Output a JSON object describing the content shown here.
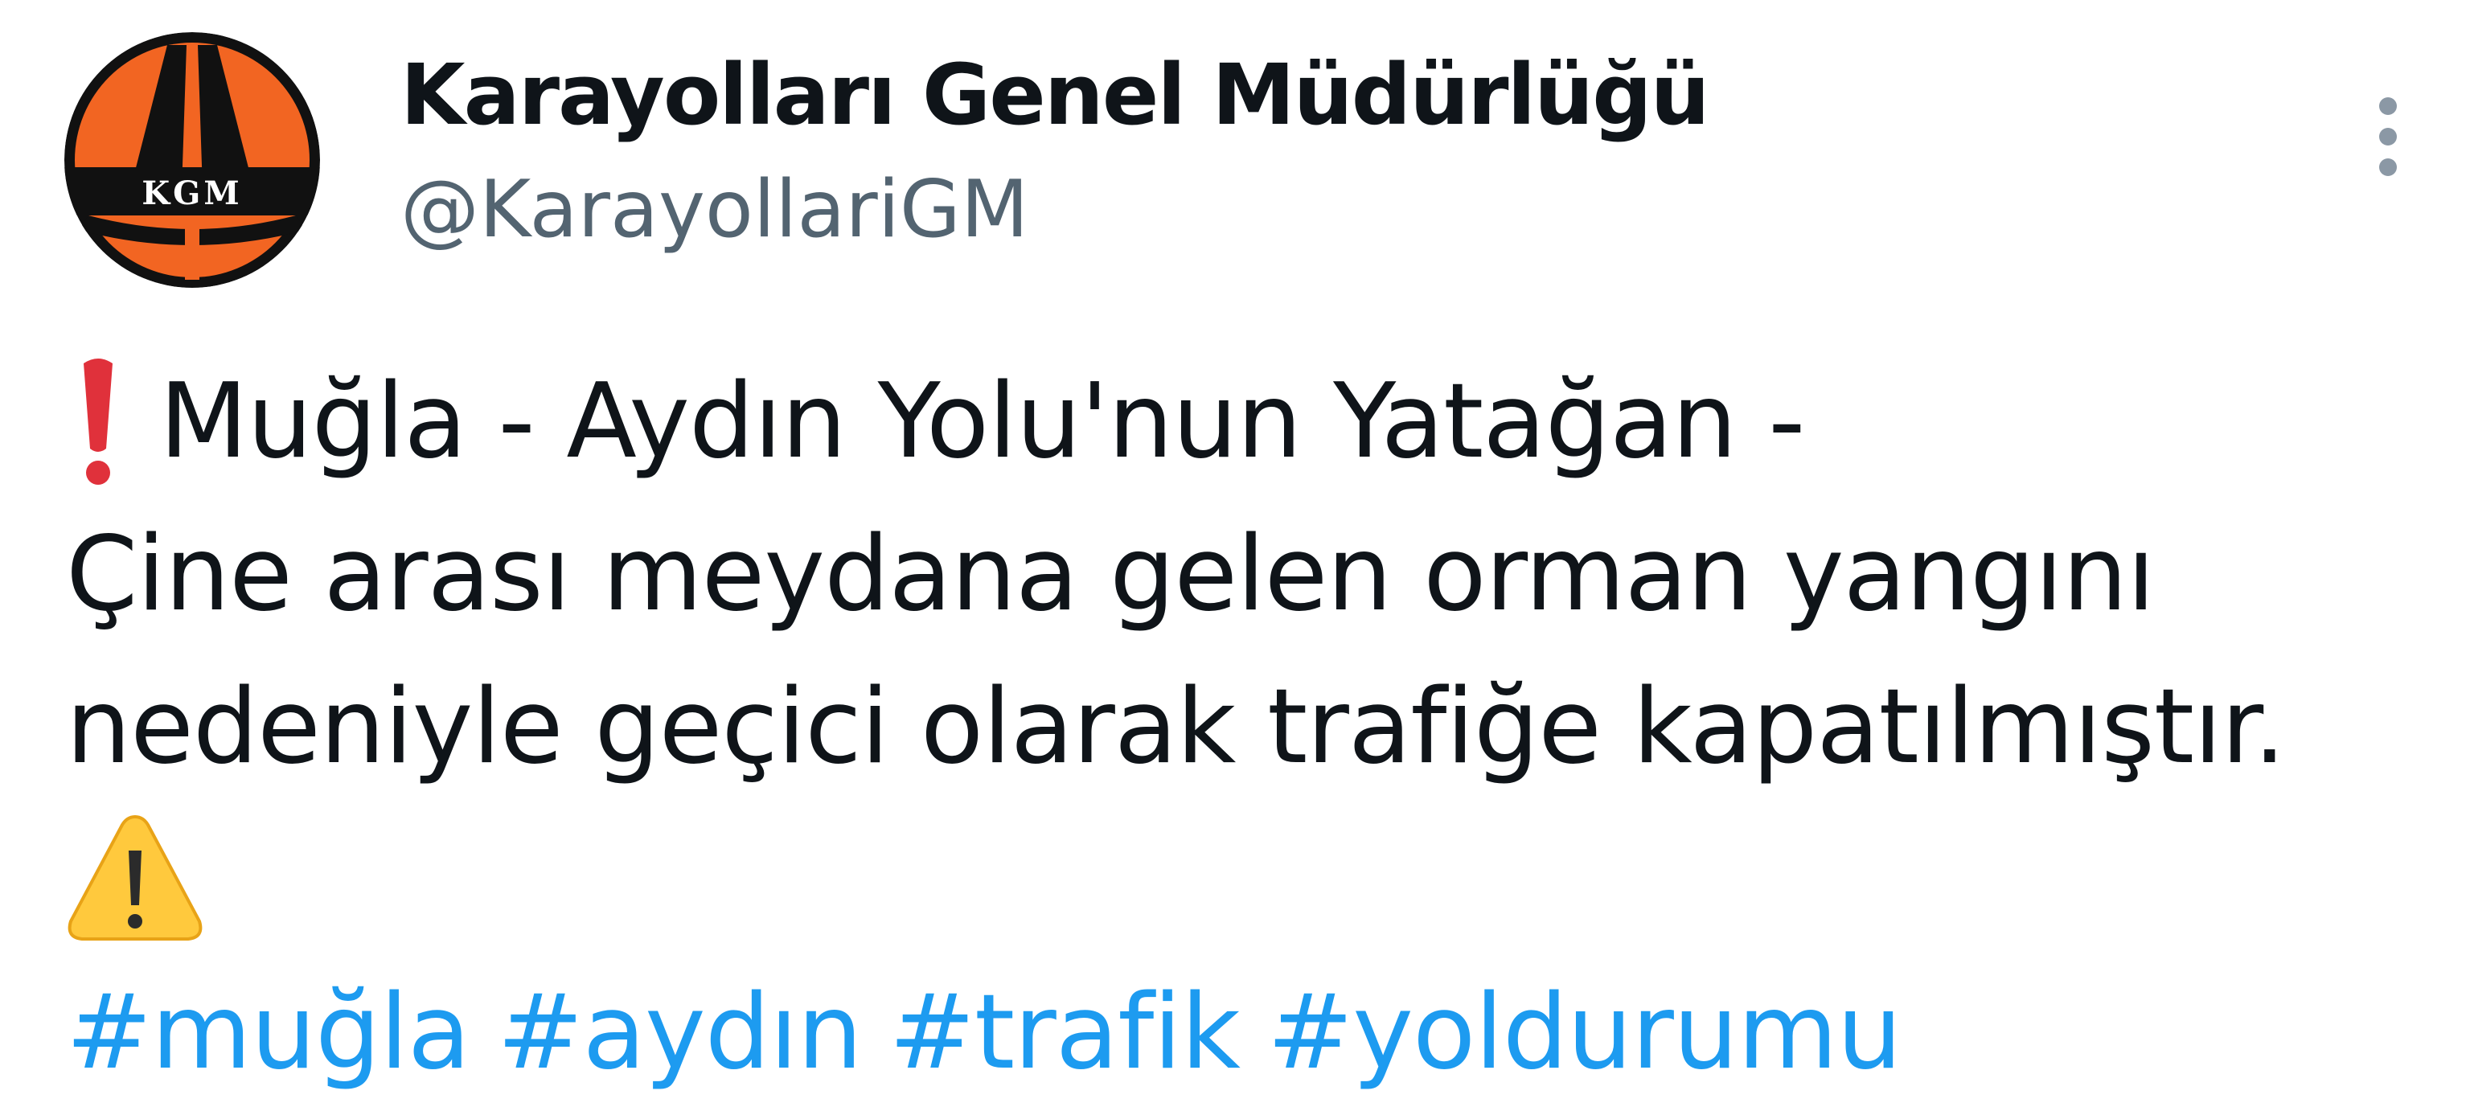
{
  "account": {
    "display_name": "Karayolları Genel Müdürlüğü",
    "handle": "@KarayollariGM",
    "avatar_text": "KGM"
  },
  "tweet": {
    "line1": "Muğla - Aydın Yolu'nun Yatağan -",
    "line2": "Çine arası meydana gelen orman yangını",
    "line3": "nedeniyle geçici olarak trafiğe kapatılmıştır.",
    "hashtags": [
      "#muğla",
      "#aydın",
      "#trafik",
      "#yoldurumu"
    ]
  },
  "icons": {
    "more": "more-vertical-icon",
    "exclamation": "red-exclamation-icon",
    "warning": "warning-sign-icon"
  },
  "colors": {
    "text": "#0f1419",
    "secondary": "#536471",
    "link": "#1d9bf0",
    "logo_orange": "#f26522",
    "logo_black": "#111111"
  }
}
